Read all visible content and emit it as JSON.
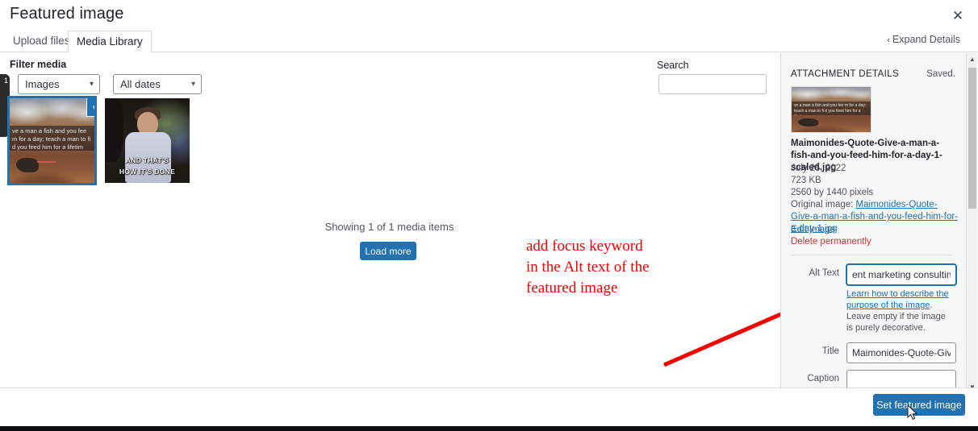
{
  "modal": {
    "title": "Featured image",
    "close_icon": "close-icon"
  },
  "tabs": [
    {
      "label": "Upload files",
      "active": false
    },
    {
      "label": "Media Library",
      "active": true
    }
  ],
  "expand_details": {
    "label": "Expand Details",
    "chevron": "‹"
  },
  "toolbar": {
    "filter_label": "Filter media",
    "type_filter": "Images",
    "date_filter": "All dates",
    "caret": "⌄",
    "search_label": "Search",
    "search_value": "",
    "search_placeholder": ""
  },
  "grid": {
    "items": [
      {
        "name": "maimonides-quote-thumbnail",
        "selected": true,
        "check_glyph": "✔",
        "quote_text": "ve a man a fish and you fee m for a day; teach a man to fi d you feed him for a lifetim"
      },
      {
        "name": "and-thats-how-its-done-gif",
        "selected": false,
        "caption_line1": "AND THAT'S",
        "caption_line2": "HOW IT'S DONE"
      }
    ],
    "showing_text": "Showing 1 of 1 media items",
    "load_more_label": "Load more",
    "tooltip_badge": "1"
  },
  "annotation": {
    "line1": "add focus keyword",
    "line2": "in the Alt text of the",
    "line3": "featured image",
    "color": "#f40000"
  },
  "sidebar": {
    "heading": "ATTACHMENT DETAILS",
    "saved_status": "Saved.",
    "filename": "Maimonides-Quote-Give-a-man-a-fish-and-you-feed-him-for-a-day-1-scaled.jpg",
    "date": "July 25, 2022",
    "filesize": "723 KB",
    "dimensions": "2560 by 1440 pixels",
    "original_image_label": "Original image:",
    "original_image_link": "Maimonides-Quote-Give-a-man-a-fish-and-you-feed-him-for-a-day-1.jpg",
    "edit_image_label": "Edit Image",
    "delete_label": "Delete permanently",
    "fields": {
      "alt_text_label": "Alt Text",
      "alt_text_value": "ent marketing consulting",
      "alt_help_link": "Learn how to describe the purpose of the image",
      "alt_help_rest": ". Leave empty if the image is purely decorative.",
      "title_label": "Title",
      "title_value": "Maimonides-Quote-Give-",
      "caption_label": "Caption",
      "caption_value": ""
    },
    "scrollbar": {
      "up_glyph": "▲",
      "down_glyph": "▼"
    }
  },
  "footer": {
    "set_featured_label": "Set featured image"
  },
  "colors": {
    "accent_blue": "#2271b1",
    "annotation_red": "#f40000",
    "delete_red": "#d63638",
    "panel_bg": "#f6f7f7"
  }
}
